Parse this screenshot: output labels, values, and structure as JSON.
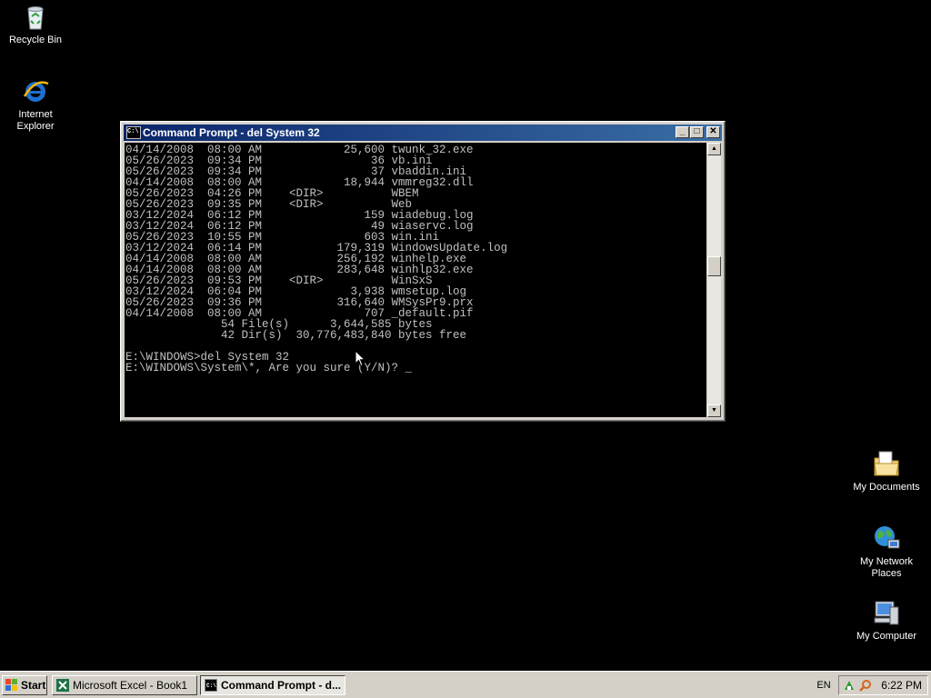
{
  "desktop": {
    "recycle_bin": "Recycle Bin",
    "internet_explorer": "Internet\nExplorer",
    "my_documents": "My Documents",
    "my_network_places": "My Network\nPlaces",
    "my_computer": "My Computer"
  },
  "window": {
    "title": "Command Prompt - del System 32",
    "minimize": "_",
    "maximize": "□",
    "close": "✕"
  },
  "console": {
    "lines": [
      "04/14/2008  08:00 AM            25,600 twunk_32.exe",
      "05/26/2023  09:34 PM                36 vb.ini",
      "05/26/2023  09:34 PM                37 vbaddin.ini",
      "04/14/2008  08:00 AM            18,944 vmmreg32.dll",
      "05/26/2023  04:26 PM    <DIR>          WBEM",
      "05/26/2023  09:35 PM    <DIR>          Web",
      "03/12/2024  06:12 PM               159 wiadebug.log",
      "03/12/2024  06:12 PM                49 wiaservc.log",
      "05/26/2023  10:55 PM               603 win.ini",
      "03/12/2024  06:14 PM           179,319 WindowsUpdate.log",
      "04/14/2008  08:00 AM           256,192 winhelp.exe",
      "04/14/2008  08:00 AM           283,648 winhlp32.exe",
      "05/26/2023  09:53 PM    <DIR>          WinSxS",
      "03/12/2024  06:04 PM             3,938 wmsetup.log",
      "05/26/2023  09:36 PM           316,640 WMSysPr9.prx",
      "04/14/2008  08:00 AM               707 _default.pif",
      "              54 File(s)      3,644,585 bytes",
      "              42 Dir(s)  30,776,483,840 bytes free",
      "",
      "E:\\WINDOWS>del System 32",
      "E:\\WINDOWS\\System\\*, Are you sure (Y/N)? _"
    ]
  },
  "taskbar": {
    "start": "Start",
    "tasks": [
      "Microsoft Excel - Book1",
      "Command Prompt - d..."
    ],
    "language": "EN",
    "clock": "6:22 PM"
  }
}
